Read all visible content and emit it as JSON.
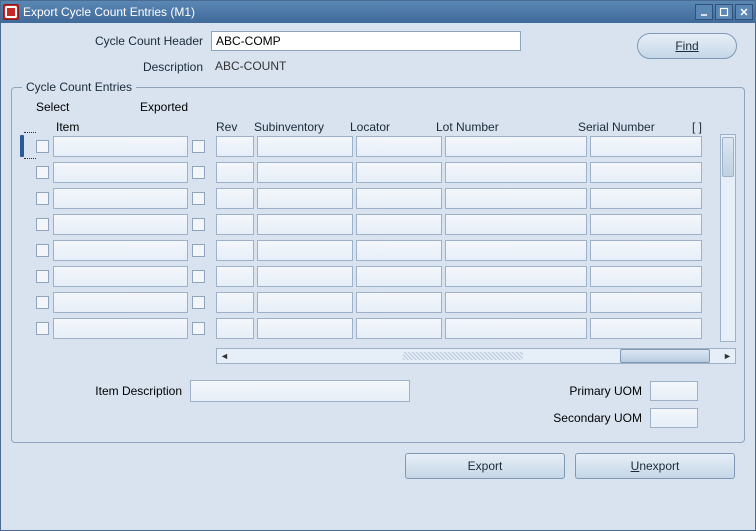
{
  "titlebar": {
    "title": "Export Cycle Count Entries (M1)"
  },
  "header": {
    "cycle_count_label": "Cycle Count Header",
    "cycle_count_value": "ABC-COMP",
    "description_label": "Description",
    "description_value": "ABC-COUNT",
    "find_label": "Find"
  },
  "entries": {
    "fieldset_label": "Cycle Count Entries",
    "columns": {
      "select": "Select",
      "exported": "Exported",
      "item": "Item",
      "rev": "Rev",
      "subinventory": "Subinventory",
      "locator": "Locator",
      "lot_number": "Lot Number",
      "serial_number": "Serial Number",
      "overflow": "[ ]"
    },
    "rows": [
      {
        "select": false,
        "item": "",
        "exported": false,
        "rev": "",
        "sub": "",
        "loc": "",
        "lot": "",
        "ser": ""
      },
      {
        "select": false,
        "item": "",
        "exported": false,
        "rev": "",
        "sub": "",
        "loc": "",
        "lot": "",
        "ser": ""
      },
      {
        "select": false,
        "item": "",
        "exported": false,
        "rev": "",
        "sub": "",
        "loc": "",
        "lot": "",
        "ser": ""
      },
      {
        "select": false,
        "item": "",
        "exported": false,
        "rev": "",
        "sub": "",
        "loc": "",
        "lot": "",
        "ser": ""
      },
      {
        "select": false,
        "item": "",
        "exported": false,
        "rev": "",
        "sub": "",
        "loc": "",
        "lot": "",
        "ser": ""
      },
      {
        "select": false,
        "item": "",
        "exported": false,
        "rev": "",
        "sub": "",
        "loc": "",
        "lot": "",
        "ser": ""
      },
      {
        "select": false,
        "item": "",
        "exported": false,
        "rev": "",
        "sub": "",
        "loc": "",
        "lot": "",
        "ser": ""
      },
      {
        "select": false,
        "item": "",
        "exported": false,
        "rev": "",
        "sub": "",
        "loc": "",
        "lot": "",
        "ser": ""
      }
    ]
  },
  "footer": {
    "item_desc_label": "Item Description",
    "item_desc_value": "",
    "primary_uom_label": "Primary UOM",
    "primary_uom_value": "",
    "secondary_uom_label": "Secondary UOM",
    "secondary_uom_value": ""
  },
  "actions": {
    "export": "Export",
    "unexport_prefix": "U",
    "unexport_rest": "nexport"
  }
}
